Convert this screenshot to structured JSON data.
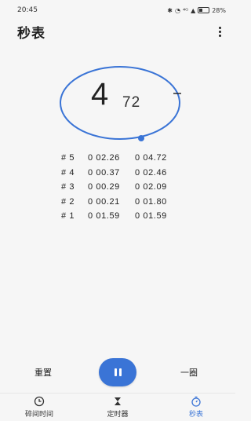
{
  "status_bar": {
    "time": "20:45",
    "network_indicator": "⁴ᴳ",
    "battery_level": "28%",
    "battery_fraction": 0.28
  },
  "header": {
    "title": "秒表"
  },
  "stopwatch": {
    "main_value": "4",
    "sub_value": "72",
    "progress_fraction": 0.72
  },
  "laps": [
    {
      "no": "# 5",
      "lap": "0 02.26",
      "total": "0 04.72"
    },
    {
      "no": "# 4",
      "lap": "0 00.37",
      "total": "0 02.46"
    },
    {
      "no": "# 3",
      "lap": "0 00.29",
      "total": "0 02.09"
    },
    {
      "no": "# 2",
      "lap": "0 00.21",
      "total": "0 01.80"
    },
    {
      "no": "# 1",
      "lap": "0 01.59",
      "total": "0 01.59"
    }
  ],
  "controls": {
    "reset_label": "重置",
    "lap_label": "一圈"
  },
  "nav": {
    "items": [
      {
        "label": "碎间时间",
        "icon": "clock-icon",
        "active": false
      },
      {
        "label": "定时器",
        "icon": "hourglass-icon",
        "active": false
      },
      {
        "label": "秒表",
        "icon": "stopwatch-icon",
        "active": true
      }
    ]
  },
  "colors": {
    "accent": "#3a74d6",
    "background": "#f6f6f6",
    "text": "#1f1f1f"
  }
}
